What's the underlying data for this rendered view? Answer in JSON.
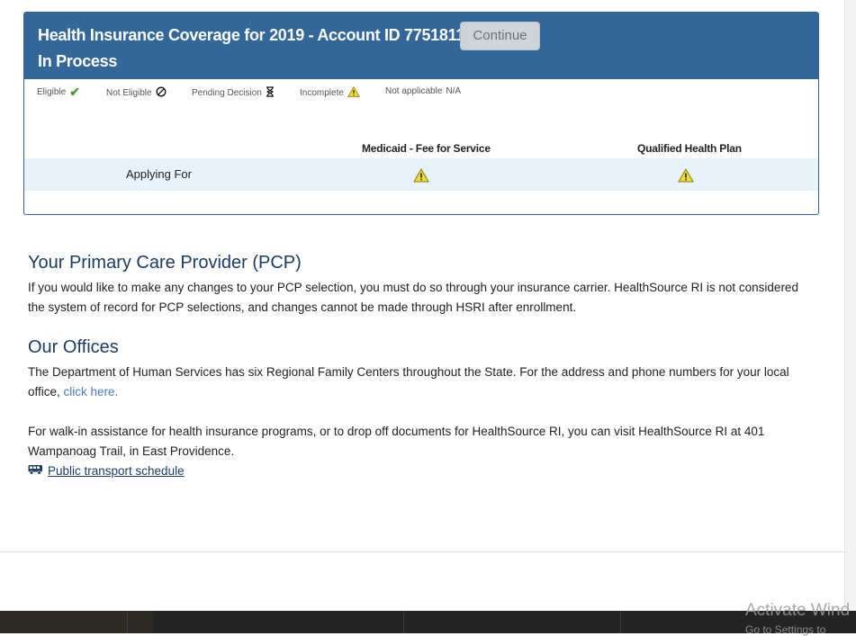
{
  "card": {
    "title": "Health Insurance Coverage for 2019 - Account ID 775181126",
    "status": "In Process",
    "continue_label": "Continue",
    "header_color": "#336699",
    "legend": [
      {
        "label": "Eligible",
        "icon": "check-icon"
      },
      {
        "label": "Not Eligible",
        "icon": "not-eligible-icon"
      },
      {
        "label": "Pending Decision",
        "icon": "hourglass-icon"
      },
      {
        "label": "Incomplete",
        "icon": "warning-icon"
      },
      {
        "label": "Not applicable",
        "icon_text": "N/A"
      }
    ],
    "columns": [
      "Medicaid - Fee for Service",
      "Qualified Health Plan"
    ],
    "row_label": "Applying For",
    "row_statuses": [
      "warning-icon",
      "warning-icon"
    ]
  },
  "pcp": {
    "heading": "Your Primary Care Provider (PCP)",
    "body": "If you would like to make any changes to your PCP selection, you must do so through your insurance carrier. HealthSource RI is not considered the system of record for PCP selections, and changes cannot be made through HSRI after enrollment."
  },
  "offices": {
    "heading": "Our Offices",
    "body_before_link": "The Department of Human Services has six Regional Family Centers throughout the State. For the address and phone numbers for your local office, ",
    "link": "click here.",
    "walkin": "For walk-in assistance for health insurance programs, or to drop off documents for HealthSource RI, you can visit HealthSource RI at 401 Wampanoag Trail, in East Providence.",
    "transport_link": "Public transport schedule"
  },
  "os": {
    "watermark": "Activate Wind",
    "watermark_sub": "Go to Settings to"
  }
}
